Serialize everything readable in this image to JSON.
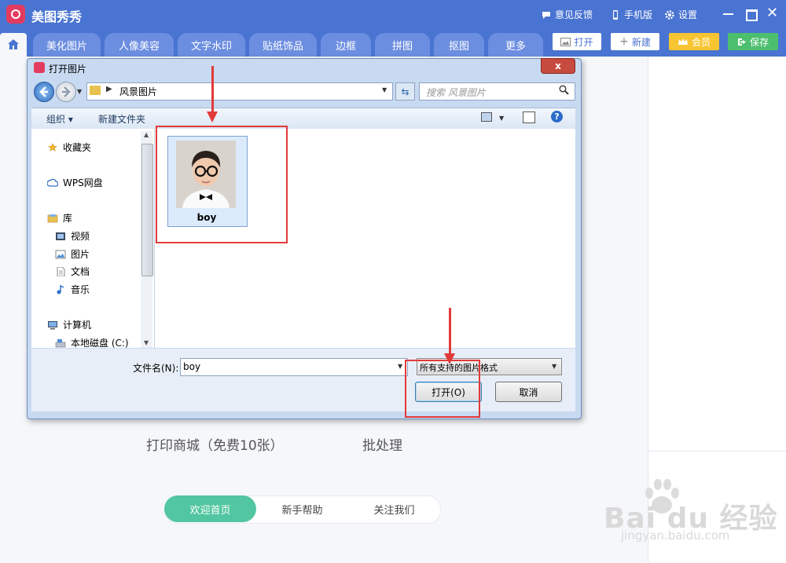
{
  "app": {
    "title": "美图秀秀",
    "feedback": "意见反馈",
    "mobile": "手机版",
    "settings": "设置"
  },
  "nav": {
    "tabs": [
      "美化图片",
      "人像美容",
      "文字水印",
      "贴纸饰品",
      "边框",
      "拼图",
      "抠图",
      "更多"
    ],
    "open_label": "打开",
    "new_label": "新建",
    "vip_label": "会员",
    "save_label": "保存"
  },
  "welcome": {
    "print_mall": "打印商城（免费10张）",
    "batch": "批处理",
    "tabs": [
      "欢迎首页",
      "新手帮助",
      "关注我们"
    ]
  },
  "watermark": {
    "brand": "Bai du 经验",
    "url": "jingyan.baidu.com"
  },
  "dialog": {
    "title": "打开图片",
    "close": "x",
    "address_path": "风景图片",
    "search_placeholder": "搜索 风景图片",
    "organize": "组织 ▾",
    "new_folder": "新建文件夹",
    "help": "?",
    "nav_items": [
      {
        "label": "收藏夹",
        "icon": "star-icon"
      },
      {
        "label": "WPS网盘",
        "icon": "cloud-icon"
      },
      {
        "label": "库",
        "icon": "library-icon"
      },
      {
        "label": "视频",
        "icon": "video-icon"
      },
      {
        "label": "图片",
        "icon": "picture-icon"
      },
      {
        "label": "文档",
        "icon": "document-icon"
      },
      {
        "label": "音乐",
        "icon": "music-icon"
      },
      {
        "label": "计算机",
        "icon": "computer-icon"
      },
      {
        "label": "本地磁盘 (C:)",
        "icon": "disk-icon"
      }
    ],
    "file": {
      "name": "boy"
    },
    "filename_label": "文件名(N):",
    "filename_value": "boy",
    "filter_value": "所有支持的图片格式",
    "open_button": "打开(O)",
    "cancel_button": "取消"
  },
  "colors": {
    "brand_blue": "#4a74d2",
    "accent_green": "#52c6a0",
    "annotation_red": "#e23a3a",
    "vip_gold": "#f7c531",
    "save_green": "#4cbf6e"
  }
}
